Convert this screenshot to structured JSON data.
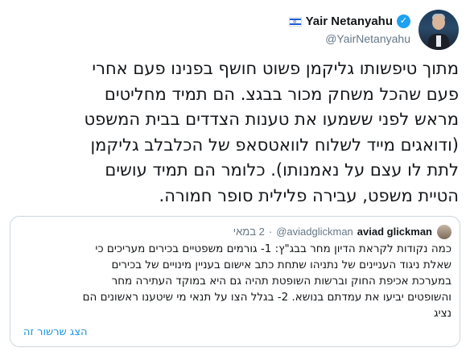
{
  "author": {
    "display_name": "Yair Netanyahu",
    "handle": "@YairNetanyahu",
    "verified_icon": "verified-badge-icon",
    "flag_icon": "israel-flag-icon",
    "flag_star": "✡"
  },
  "tweet": {
    "text": "מתוך טיפשותו גליקמן  פשוט חושף בפנינו פעם אחרי\nפעם שהכל משחק מכור בבגצ. הם תמיד מחליטים\nמראש לפני ששמעו את טענות הצדדים בבית המשפט\n(ודואגים מייד לשלוח לוואטסאפ של הכלבלב גליקמן\nלתת לו עצם על נאמנותו). כלומר הם תמיד עושים\nהטיית משפט, עבירה פלילית סופר חמורה."
  },
  "quoted_tweet": {
    "name": "aviad glickman",
    "handle": "@aviadglickman",
    "dot": "·",
    "time": "2 במאי",
    "text": "כמה נקודות לקראת הדיון מחר בבג\"ץ: 1- גורמים משפטיים בכירים מעריכים כי\nשאלת ניגוד העניינים של נתניהו שתחת כתב אישום בעניין מינויים של בכירים\nבמערכת אכיפת החוק וברשות השופטת תהיה גם היא במוקד העתירה מחר\nוהשופטים יביעו את עמדתם בנושא. 2- בגלל הצו על תנאי מי שיטענו ראשונים הם\nנציג",
    "show_thread": "הצג שרשור זה"
  },
  "colors": {
    "text": "#14171a",
    "secondary": "#657786",
    "link": "#1b95e0",
    "verified": "#1da1f2",
    "border": "#ccd6dd"
  }
}
